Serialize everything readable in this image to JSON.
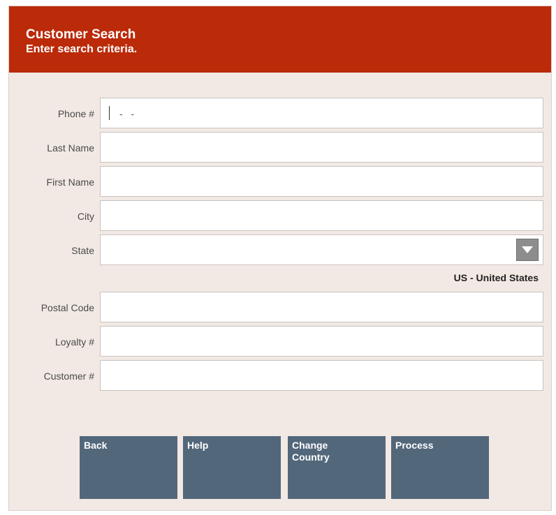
{
  "header": {
    "title": "Customer Search",
    "subtitle": "Enter search criteria."
  },
  "fields": {
    "phone": {
      "label": "Phone #",
      "mask": "- -"
    },
    "last_name": {
      "label": "Last Name",
      "value": ""
    },
    "first_name": {
      "label": "First Name",
      "value": ""
    },
    "city": {
      "label": "City",
      "value": ""
    },
    "state": {
      "label": "State",
      "value": "",
      "icon": "chevron-down-icon"
    },
    "postal_code": {
      "label": "Postal Code",
      "value": ""
    },
    "loyalty": {
      "label": "Loyalty #",
      "value": ""
    },
    "customer": {
      "label": "Customer #",
      "value": ""
    }
  },
  "country": "US - United States",
  "buttons": {
    "back": "Back",
    "help": "Help",
    "change_country": "Change\nCountry",
    "process": "Process"
  },
  "colors": {
    "header_bg": "#bb2a09",
    "panel_bg": "#f2e9e4",
    "button_bg": "#53677b"
  }
}
